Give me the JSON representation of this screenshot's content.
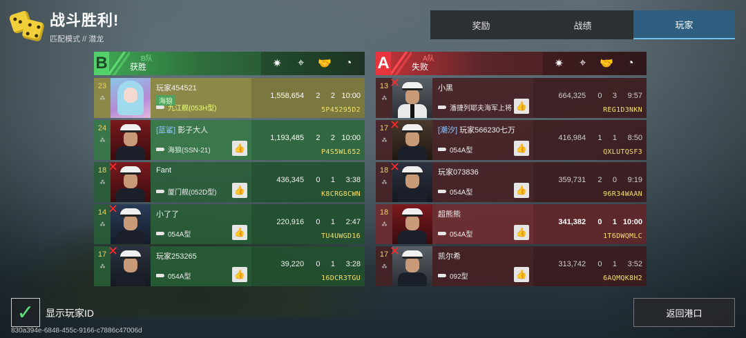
{
  "header": {
    "title": "战斗胜利!",
    "mode": "匹配模式",
    "separator": "//",
    "map": "潜龙"
  },
  "tabs": [
    {
      "label": "奖励",
      "active": false
    },
    {
      "label": "战绩",
      "active": false
    },
    {
      "label": "玩家",
      "active": true
    }
  ],
  "teams": {
    "b": {
      "letter": "B",
      "name": "B队",
      "result": "获胜",
      "players": [
        {
          "level": "23",
          "name": "玩家454521",
          "guild": "",
          "badge": "海狼",
          "ship": "九江舰(053H型)",
          "damage": "1,558,654",
          "kills": "2",
          "assists": "2",
          "time": "10:00",
          "id": "5P45295D2",
          "dead": false
        },
        {
          "level": "24",
          "name": "影子大人",
          "guild": "[蓝鲨]",
          "badge": "",
          "ship": "海狼(SSN-21)",
          "damage": "1,193,485",
          "kills": "2",
          "assists": "2",
          "time": "10:00",
          "id": "P4S5WL652",
          "dead": false
        },
        {
          "level": "18",
          "name": "Fant",
          "guild": "",
          "badge": "",
          "ship": "厦门舰(052D型)",
          "damage": "436,345",
          "kills": "0",
          "assists": "1",
          "time": "3:38",
          "id": "K8CRG8CWN",
          "dead": true
        },
        {
          "level": "14",
          "name": "小了了",
          "guild": "",
          "badge": "",
          "ship": "054A型",
          "damage": "220,916",
          "kills": "0",
          "assists": "1",
          "time": "2:47",
          "id": "TU4UWGD16",
          "dead": true
        },
        {
          "level": "17",
          "name": "玩家253265",
          "guild": "",
          "badge": "",
          "ship": "054A型",
          "damage": "39,220",
          "kills": "0",
          "assists": "1",
          "time": "3:28",
          "id": "16DCR3TGU",
          "dead": true
        }
      ]
    },
    "a": {
      "letter": "A",
      "name": "A队",
      "result": "失败",
      "players": [
        {
          "level": "13",
          "name": "小黑",
          "guild": "",
          "badge": "",
          "ship": "潘捷列耶夫海军上将",
          "damage": "664,325",
          "kills": "0",
          "assists": "3",
          "time": "9:57",
          "id": "REG1D3NKN",
          "dead": true
        },
        {
          "level": "17",
          "name": "玩家566230七万",
          "guild": "[潮汐]",
          "badge": "",
          "ship": "054A型",
          "damage": "416,984",
          "kills": "1",
          "assists": "1",
          "time": "8:50",
          "id": "QXLUTQSF3",
          "dead": true
        },
        {
          "level": "18",
          "name": "玩家073836",
          "guild": "",
          "badge": "",
          "ship": "054A型",
          "damage": "359,731",
          "kills": "2",
          "assists": "0",
          "time": "9:19",
          "id": "96R34WAAN",
          "dead": true
        },
        {
          "level": "18",
          "name": "超熊熊",
          "guild": "",
          "badge": "",
          "ship": "054A型",
          "damage": "341,382",
          "kills": "0",
          "assists": "1",
          "time": "10:00",
          "id": "1T6DWQMLC",
          "dead": false
        },
        {
          "level": "17",
          "name": "凯尔希",
          "guild": "",
          "badge": "",
          "ship": "092型",
          "damage": "313,742",
          "kills": "0",
          "assists": "1",
          "time": "3:52",
          "id": "6AQMQK8H2",
          "dead": true
        }
      ]
    }
  },
  "footer": {
    "show_id_label": "显示玩家ID",
    "show_id_checked": true,
    "uuid": "830a394e-6848-455c-9166-c7886c47006d",
    "back_label": "返回港口"
  }
}
